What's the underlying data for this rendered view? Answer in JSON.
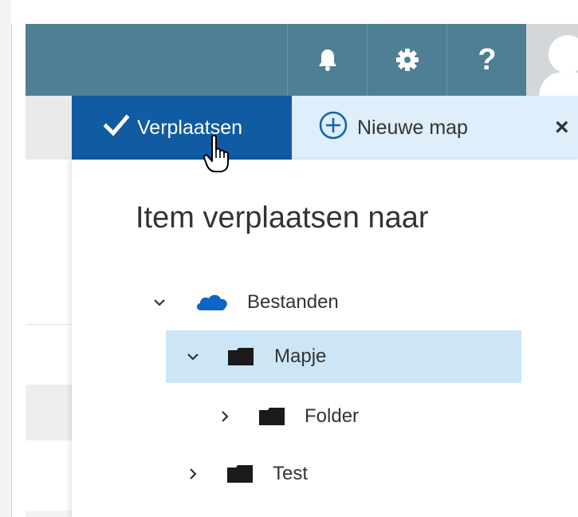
{
  "topbar": {
    "icons": [
      {
        "name": "bell-icon"
      },
      {
        "name": "gear-icon"
      },
      {
        "name": "help-icon",
        "label": "?"
      }
    ],
    "avatar": "person-icon"
  },
  "actionbar": {
    "move_label": "Verplaatsen",
    "new_folder_label": "Nieuwe map",
    "close_label": "×"
  },
  "panel": {
    "title": "Item verplaatsen naar",
    "tree": [
      {
        "label": "Bestanden",
        "icon": "onedrive-cloud-icon",
        "expanded": true,
        "level": 0,
        "selected": false
      },
      {
        "label": "Mapje",
        "icon": "folder-icon",
        "expanded": true,
        "level": 1,
        "selected": true
      },
      {
        "label": "Folder",
        "icon": "folder-icon",
        "expanded": false,
        "level": 2,
        "selected": false
      },
      {
        "label": "Test",
        "icon": "folder-icon",
        "expanded": false,
        "level": 1,
        "selected": false
      }
    ]
  },
  "colors": {
    "topbar": "#4e7f94",
    "primary_button": "#105ba2",
    "actionbar": "#deeefa",
    "selected_row": "#cde6f7",
    "onedrive": "#0f64c8"
  }
}
